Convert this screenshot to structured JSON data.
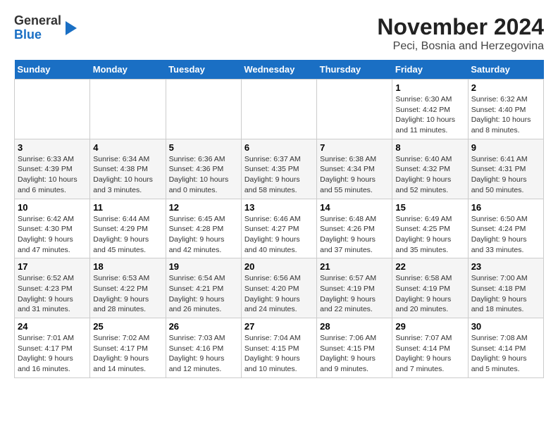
{
  "logo": {
    "general": "General",
    "blue": "Blue"
  },
  "title": "November 2024",
  "subtitle": "Peci, Bosnia and Herzegovina",
  "days_of_week": [
    "Sunday",
    "Monday",
    "Tuesday",
    "Wednesday",
    "Thursday",
    "Friday",
    "Saturday"
  ],
  "weeks": [
    [
      {
        "day": "",
        "info": ""
      },
      {
        "day": "",
        "info": ""
      },
      {
        "day": "",
        "info": ""
      },
      {
        "day": "",
        "info": ""
      },
      {
        "day": "",
        "info": ""
      },
      {
        "day": "1",
        "info": "Sunrise: 6:30 AM\nSunset: 4:42 PM\nDaylight: 10 hours and 11 minutes."
      },
      {
        "day": "2",
        "info": "Sunrise: 6:32 AM\nSunset: 4:40 PM\nDaylight: 10 hours and 8 minutes."
      }
    ],
    [
      {
        "day": "3",
        "info": "Sunrise: 6:33 AM\nSunset: 4:39 PM\nDaylight: 10 hours and 6 minutes."
      },
      {
        "day": "4",
        "info": "Sunrise: 6:34 AM\nSunset: 4:38 PM\nDaylight: 10 hours and 3 minutes."
      },
      {
        "day": "5",
        "info": "Sunrise: 6:36 AM\nSunset: 4:36 PM\nDaylight: 10 hours and 0 minutes."
      },
      {
        "day": "6",
        "info": "Sunrise: 6:37 AM\nSunset: 4:35 PM\nDaylight: 9 hours and 58 minutes."
      },
      {
        "day": "7",
        "info": "Sunrise: 6:38 AM\nSunset: 4:34 PM\nDaylight: 9 hours and 55 minutes."
      },
      {
        "day": "8",
        "info": "Sunrise: 6:40 AM\nSunset: 4:32 PM\nDaylight: 9 hours and 52 minutes."
      },
      {
        "day": "9",
        "info": "Sunrise: 6:41 AM\nSunset: 4:31 PM\nDaylight: 9 hours and 50 minutes."
      }
    ],
    [
      {
        "day": "10",
        "info": "Sunrise: 6:42 AM\nSunset: 4:30 PM\nDaylight: 9 hours and 47 minutes."
      },
      {
        "day": "11",
        "info": "Sunrise: 6:44 AM\nSunset: 4:29 PM\nDaylight: 9 hours and 45 minutes."
      },
      {
        "day": "12",
        "info": "Sunrise: 6:45 AM\nSunset: 4:28 PM\nDaylight: 9 hours and 42 minutes."
      },
      {
        "day": "13",
        "info": "Sunrise: 6:46 AM\nSunset: 4:27 PM\nDaylight: 9 hours and 40 minutes."
      },
      {
        "day": "14",
        "info": "Sunrise: 6:48 AM\nSunset: 4:26 PM\nDaylight: 9 hours and 37 minutes."
      },
      {
        "day": "15",
        "info": "Sunrise: 6:49 AM\nSunset: 4:25 PM\nDaylight: 9 hours and 35 minutes."
      },
      {
        "day": "16",
        "info": "Sunrise: 6:50 AM\nSunset: 4:24 PM\nDaylight: 9 hours and 33 minutes."
      }
    ],
    [
      {
        "day": "17",
        "info": "Sunrise: 6:52 AM\nSunset: 4:23 PM\nDaylight: 9 hours and 31 minutes."
      },
      {
        "day": "18",
        "info": "Sunrise: 6:53 AM\nSunset: 4:22 PM\nDaylight: 9 hours and 28 minutes."
      },
      {
        "day": "19",
        "info": "Sunrise: 6:54 AM\nSunset: 4:21 PM\nDaylight: 9 hours and 26 minutes."
      },
      {
        "day": "20",
        "info": "Sunrise: 6:56 AM\nSunset: 4:20 PM\nDaylight: 9 hours and 24 minutes."
      },
      {
        "day": "21",
        "info": "Sunrise: 6:57 AM\nSunset: 4:19 PM\nDaylight: 9 hours and 22 minutes."
      },
      {
        "day": "22",
        "info": "Sunrise: 6:58 AM\nSunset: 4:19 PM\nDaylight: 9 hours and 20 minutes."
      },
      {
        "day": "23",
        "info": "Sunrise: 7:00 AM\nSunset: 4:18 PM\nDaylight: 9 hours and 18 minutes."
      }
    ],
    [
      {
        "day": "24",
        "info": "Sunrise: 7:01 AM\nSunset: 4:17 PM\nDaylight: 9 hours and 16 minutes."
      },
      {
        "day": "25",
        "info": "Sunrise: 7:02 AM\nSunset: 4:17 PM\nDaylight: 9 hours and 14 minutes."
      },
      {
        "day": "26",
        "info": "Sunrise: 7:03 AM\nSunset: 4:16 PM\nDaylight: 9 hours and 12 minutes."
      },
      {
        "day": "27",
        "info": "Sunrise: 7:04 AM\nSunset: 4:15 PM\nDaylight: 9 hours and 10 minutes."
      },
      {
        "day": "28",
        "info": "Sunrise: 7:06 AM\nSunset: 4:15 PM\nDaylight: 9 hours and 9 minutes."
      },
      {
        "day": "29",
        "info": "Sunrise: 7:07 AM\nSunset: 4:14 PM\nDaylight: 9 hours and 7 minutes."
      },
      {
        "day": "30",
        "info": "Sunrise: 7:08 AM\nSunset: 4:14 PM\nDaylight: 9 hours and 5 minutes."
      }
    ]
  ]
}
